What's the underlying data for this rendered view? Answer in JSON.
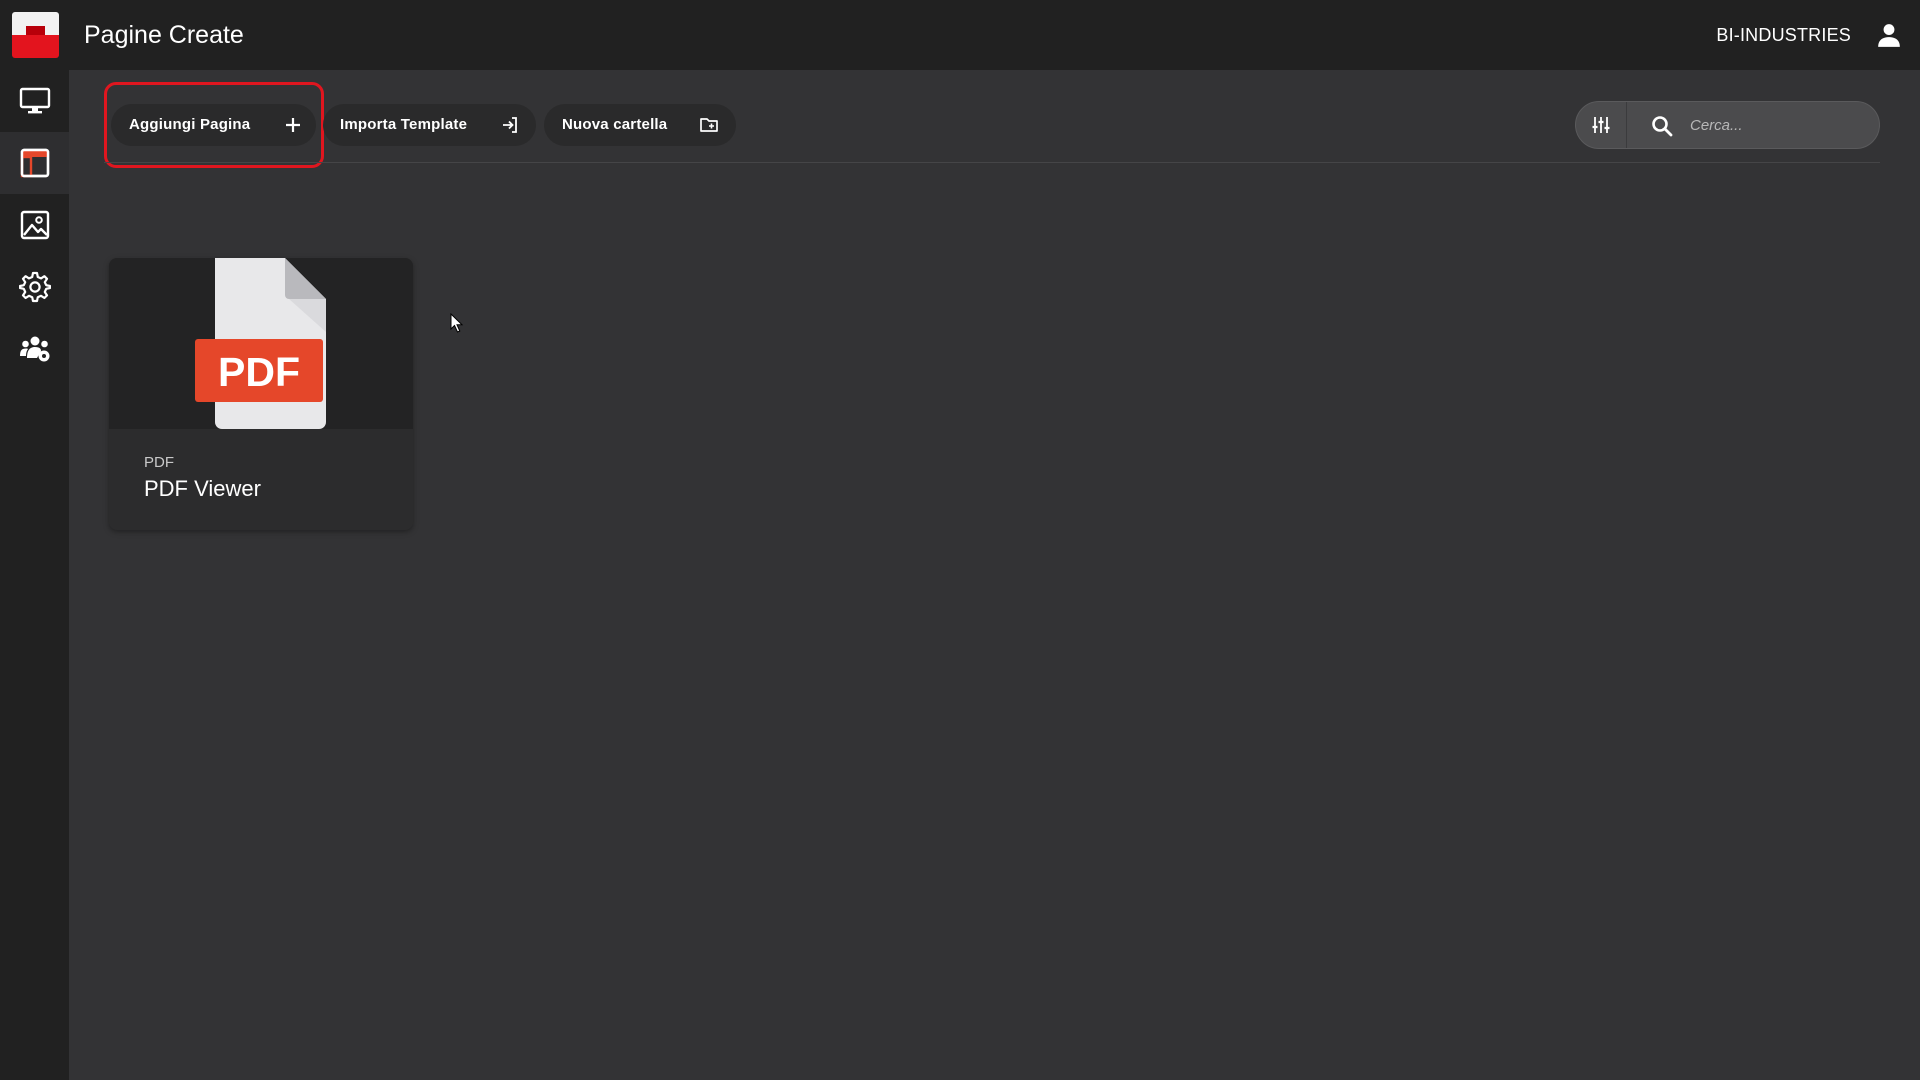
{
  "header": {
    "title": "Pagine Create",
    "organization": "BI-INDUSTRIES",
    "user_icon": "user-icon"
  },
  "sidebar": {
    "items": [
      {
        "name": "monitor",
        "icon": "monitor-icon",
        "active": false
      },
      {
        "name": "layout",
        "icon": "layout-icon",
        "active": true
      },
      {
        "name": "image",
        "icon": "image-icon",
        "active": false
      },
      {
        "name": "settings",
        "icon": "gear-icon",
        "active": false
      },
      {
        "name": "users",
        "icon": "users-gear-icon",
        "active": false
      }
    ]
  },
  "toolbar": {
    "add_page_label": "Aggiungi Pagina",
    "import_template_label": "Importa Template",
    "new_folder_label": "Nuova cartella",
    "search_placeholder": "Cerca..."
  },
  "cards": [
    {
      "type": "PDF",
      "title": "PDF Viewer",
      "thumbnail_text": "PDF"
    }
  ],
  "colors": {
    "accent": "#e0161f",
    "pdf_badge": "#e5472a",
    "background": "#333335",
    "bars": "#212121"
  }
}
